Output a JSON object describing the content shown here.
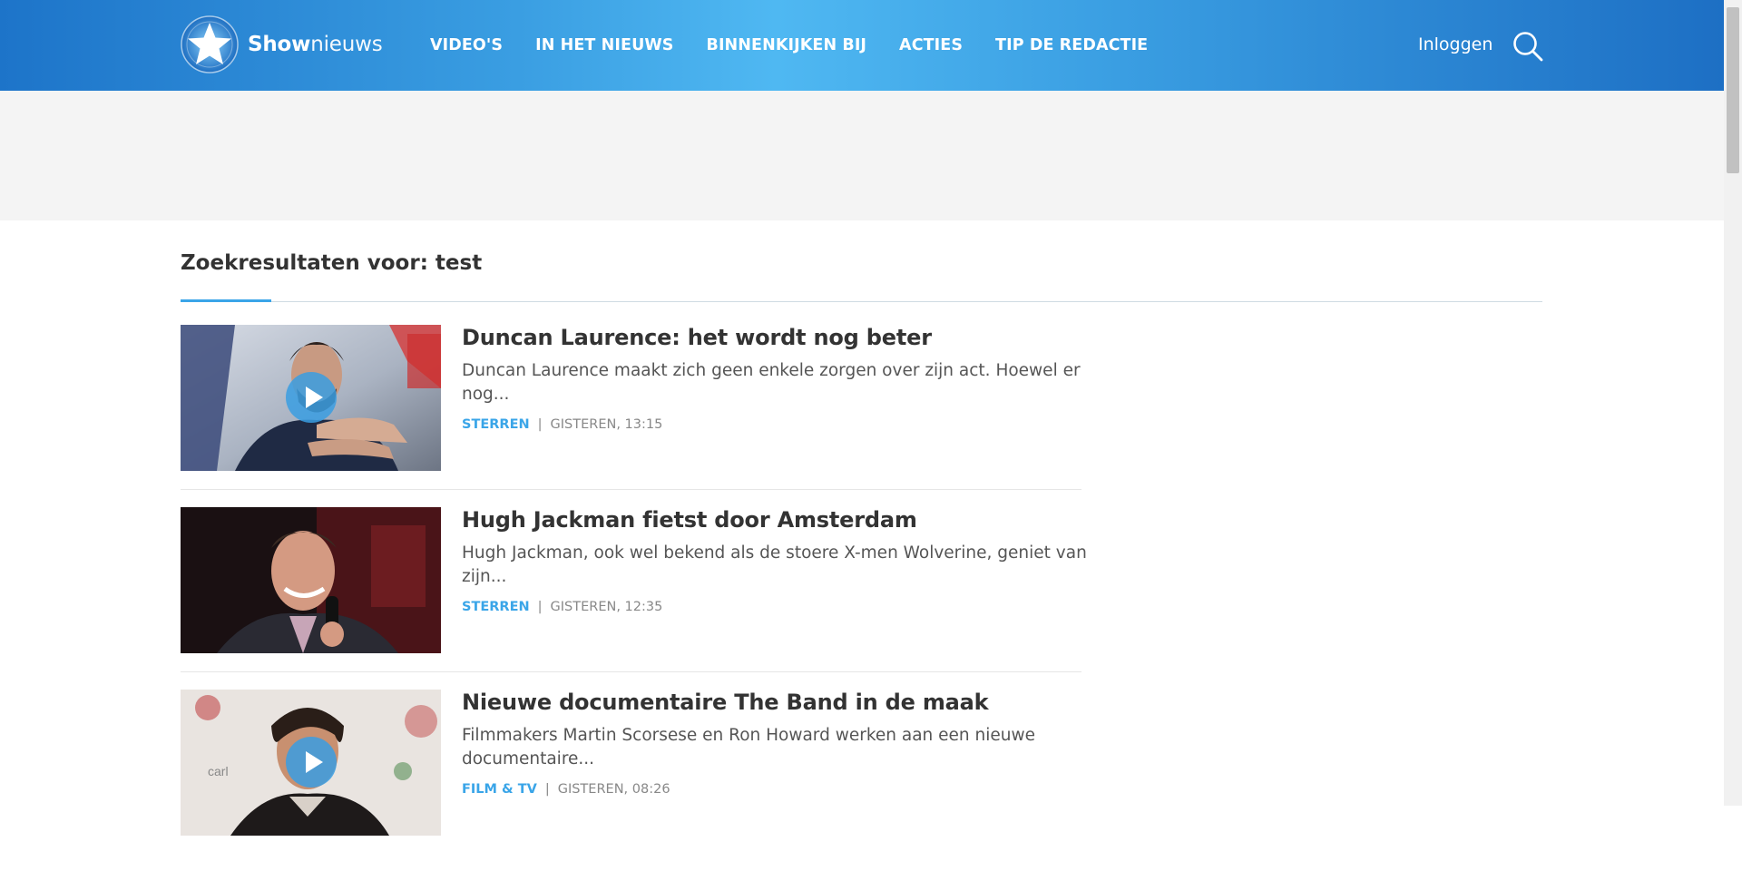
{
  "header": {
    "logo_bold": "Show",
    "logo_light": "nieuws",
    "nav": [
      "VIDEO'S",
      "IN HET NIEUWS",
      "BINNENKIJKEN BIJ",
      "ACTIES",
      "TIP DE REDACTIE"
    ],
    "login_label": "Inloggen",
    "search_icon": "search-icon",
    "colors": {
      "bar_dark": "#1d74c9",
      "bar_light": "#4fb8f2"
    }
  },
  "search": {
    "label": "Zoekresultaten voor:",
    "query": "test"
  },
  "results": [
    {
      "title": "Duncan Laurence: het wordt nog beter",
      "description": "Duncan Laurence maakt zich geen enkele zorgen over zijn act. Hoewel er nog...",
      "category": "STERREN",
      "separator": "|",
      "timestamp": "GISTEREN, 13:15",
      "has_video": true
    },
    {
      "title": "Hugh Jackman fietst door Amsterdam",
      "description": "Hugh Jackman, ook wel bekend als de stoere X-men Wolverine, geniet van zijn...",
      "category": "STERREN",
      "separator": "|",
      "timestamp": "GISTEREN, 12:35",
      "has_video": false
    },
    {
      "title": "Nieuwe documentaire The Band in de maak",
      "description": "Filmmakers Martin Scorsese en Ron Howard werken aan een nieuwe documentaire...",
      "category": "FILM & TV",
      "separator": "|",
      "timestamp": "GISTEREN, 08:26",
      "has_video": true
    }
  ],
  "accent_color": "#3aa5e8"
}
